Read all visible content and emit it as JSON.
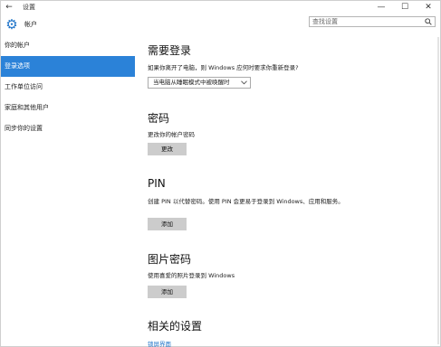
{
  "titlebar": {
    "back_glyph": "←",
    "title": "设置",
    "minimize_glyph": "—",
    "maximize_glyph": "☐",
    "close_glyph": "✕"
  },
  "header": {
    "title": "帐户",
    "icon": "gear-icon",
    "accent_color": "#1e73c8",
    "search": {
      "placeholder": "查找设置",
      "value": ""
    }
  },
  "sidebar": {
    "items": [
      {
        "label": "你的帐户",
        "active": false
      },
      {
        "label": "登录选项",
        "active": true
      },
      {
        "label": "工作单位访问",
        "active": false
      },
      {
        "label": "家庭和其他用户",
        "active": false
      },
      {
        "label": "同步你的设置",
        "active": false
      }
    ],
    "active_color": "#2b82d8"
  },
  "main": {
    "require_signin": {
      "heading": "需要登录",
      "description": "如果你离开了电脑，则 Windows 应何时要求你重新登录?",
      "selected_option": "当电脑从睡眠模式中被唤醒时"
    },
    "password": {
      "heading": "密码",
      "description": "更改你的帐户密码",
      "button": "更改"
    },
    "pin": {
      "heading": "PIN",
      "description": "创建 PIN 以代替密码。使用 PIN 会更易于登录到 Windows、应用和服务。",
      "button": "添加"
    },
    "picture_password": {
      "heading": "图片密码",
      "description": "使用喜爱的照片登录到 Windows",
      "button": "添加"
    },
    "related": {
      "heading": "相关的设置",
      "link": "锁屏界面"
    }
  }
}
